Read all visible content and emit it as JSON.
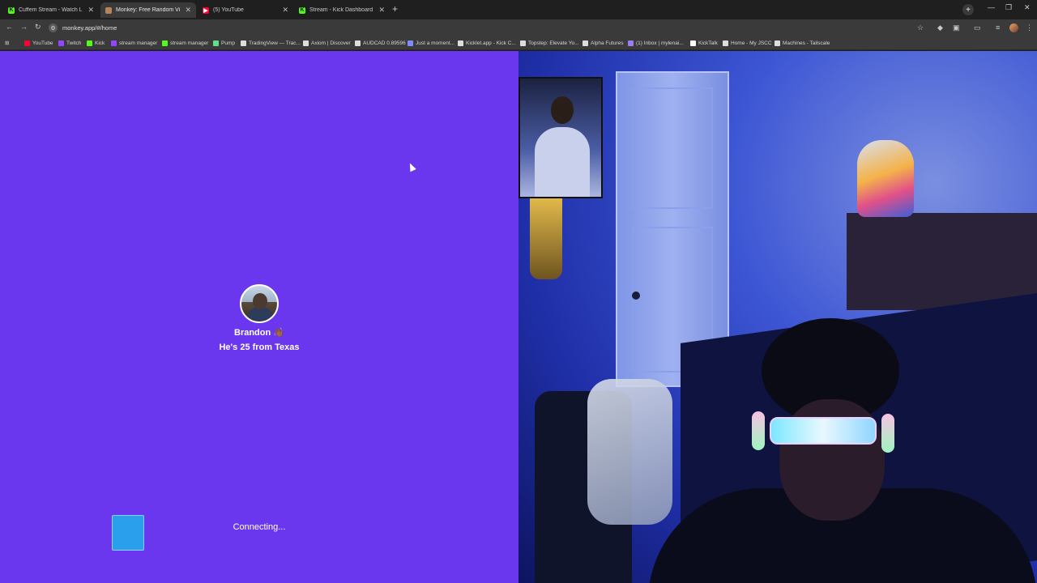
{
  "browser": {
    "tabs": [
      {
        "title": "Cuffem Stream - Watch Live on",
        "favicon": "kick-icon",
        "active": false
      },
      {
        "title": "Monkey: Free Random Vid...",
        "favicon": "monkey-icon",
        "active": true
      },
      {
        "title": "(5) YouTube",
        "favicon": "youtube-icon",
        "active": false
      },
      {
        "title": "Stream - Kick Dashboard",
        "favicon": "kick-icon",
        "active": false
      }
    ],
    "url": "monkey.app/#/home",
    "bookmarks": [
      {
        "label": "YouTube",
        "color": "#ff0033"
      },
      {
        "label": "Twitch",
        "color": "#9146ff"
      },
      {
        "label": "Kick",
        "color": "#53fc18"
      },
      {
        "label": "stream manager",
        "color": "#9146ff"
      },
      {
        "label": "stream manager",
        "color": "#53fc18"
      },
      {
        "label": "Pump",
        "color": "#5fe08a"
      },
      {
        "label": "TradingView — Trac...",
        "color": "#dddddd"
      },
      {
        "label": "Axiom | Discover",
        "color": "#dddddd"
      },
      {
        "label": "AUDCAD 0.89596",
        "color": "#dddddd"
      },
      {
        "label": "Just a moment...",
        "color": "#7f8cff"
      },
      {
        "label": "Kicklet.app - Kick C...",
        "color": "#dddddd"
      },
      {
        "label": "Topstep: Elevate Yo...",
        "color": "#dddddd"
      },
      {
        "label": "Alpha Futures",
        "color": "#dddddd"
      },
      {
        "label": "(1) Inbox | mylenai...",
        "color": "#9b7cf5"
      },
      {
        "label": "KickTalk",
        "color": "#ffffff"
      },
      {
        "label": "Home - My JSCC",
        "color": "#dddddd"
      },
      {
        "label": "Machines - Tailscale",
        "color": "#dddddd"
      }
    ]
  },
  "match": {
    "name": "Brandon",
    "name_emoji": "👋🏾",
    "sub_prefix": "He's 25 from ",
    "location": "Texas",
    "status": "Connecting..."
  },
  "colors": {
    "panel_bg": "#6a37ee",
    "indicator": "#2aa0ec"
  }
}
